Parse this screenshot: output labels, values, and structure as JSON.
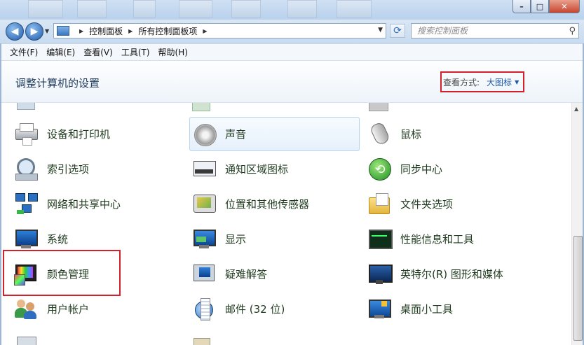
{
  "window": {
    "minimize": "–",
    "maximize": "□",
    "close": "✕"
  },
  "nav": {
    "back": "◀",
    "forward": "▶",
    "breadcrumb": [
      "控制面板",
      "所有控制面板项"
    ],
    "search_placeholder": "搜索控制面板"
  },
  "menu": [
    "文件(F)",
    "编辑(E)",
    "查看(V)",
    "工具(T)",
    "帮助(H)"
  ],
  "header": {
    "title": "调整计算机的设置",
    "view_label": "查看方式:",
    "view_value": "大图标"
  },
  "items": {
    "col1": [
      "设备和打印机",
      "索引选项",
      "网络和共享中心",
      "系统",
      "颜色管理",
      "用户帐户"
    ],
    "col2": [
      "声音",
      "通知区域图标",
      "位置和其他传感器",
      "显示",
      "疑难解答",
      "邮件 (32 位)"
    ],
    "col3": [
      "鼠标",
      "同步中心",
      "文件夹选项",
      "性能信息和工具",
      "英特尔(R) 图形和媒体",
      "桌面小工具"
    ]
  },
  "colors": {
    "highlight_border": "#d4202a",
    "link_blue": "#1a5aa8",
    "title_text": "#1e395b"
  }
}
